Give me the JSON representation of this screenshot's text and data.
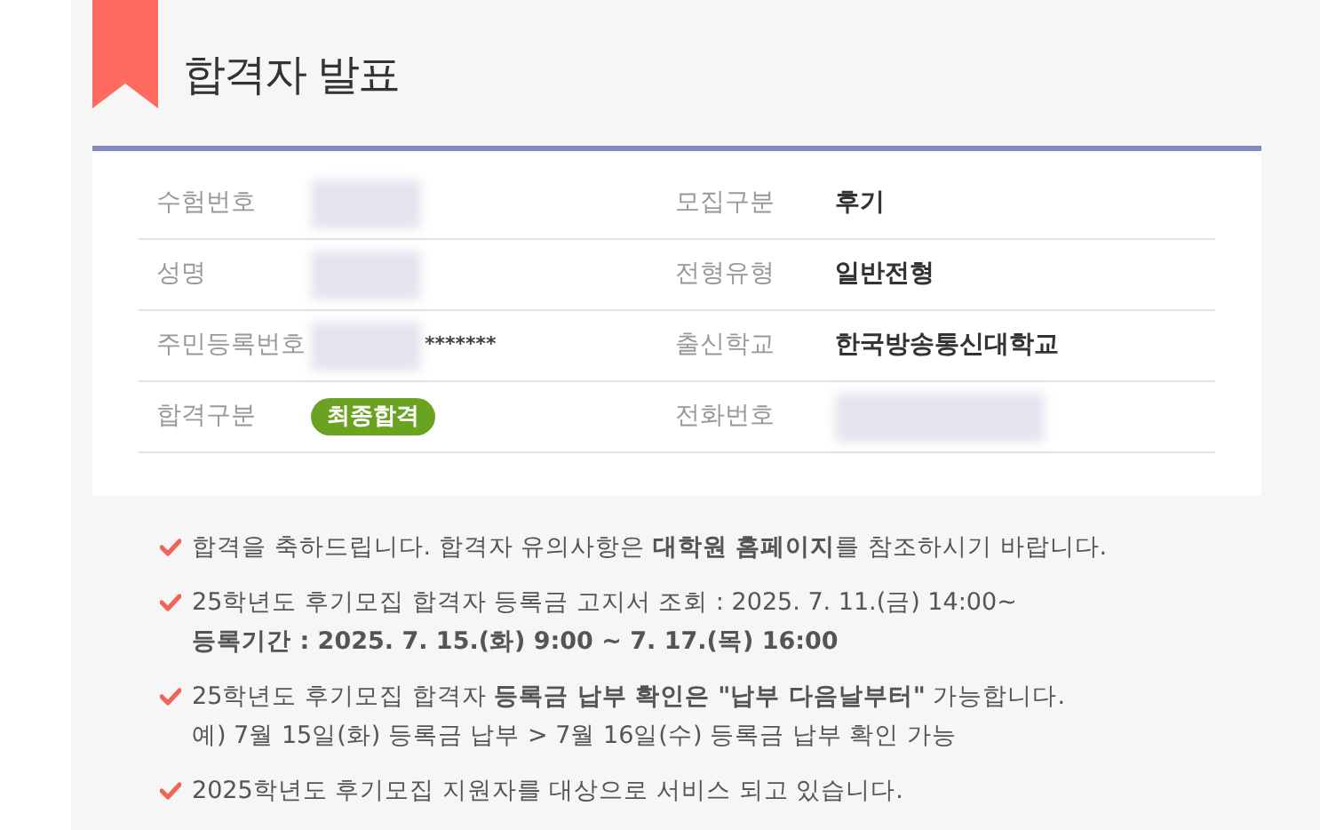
{
  "title": "합격자 발표",
  "rows": [
    {
      "left": {
        "label": "수험번호",
        "kind": "redacted"
      },
      "right": {
        "label": "모집구분",
        "kind": "text",
        "value": "후기"
      }
    },
    {
      "left": {
        "label": "성명",
        "kind": "redacted"
      },
      "right": {
        "label": "전형유형",
        "kind": "text",
        "value": "일반전형"
      }
    },
    {
      "left": {
        "label": "주민등록번호",
        "kind": "masked",
        "value": "*******"
      },
      "right": {
        "label": "출신학교",
        "kind": "text",
        "value": "한국방송통신대학교"
      }
    },
    {
      "left": {
        "label": "합격구분",
        "kind": "badge",
        "value": "최종합격"
      },
      "right": {
        "label": "전화번호",
        "kind": "redacted"
      }
    }
  ],
  "notes": [
    {
      "lines": [
        {
          "text": "합격을 축하드립니다. 합격자 유의사항은 **대학원 홈페이지**를 참조하시기 바랍니다.",
          "bold": false
        }
      ]
    },
    {
      "lines": [
        {
          "text": "25학년도 후기모집 합격자 등록금 고지서 조회 : 2025. 7. 11.(금) 14:00~",
          "bold": false
        },
        {
          "text": "등록기간 : 2025. 7. 15.(화) 9:00 ~ 7. 17.(목) 16:00",
          "bold": true
        }
      ]
    },
    {
      "lines": [
        {
          "text": "25학년도 후기모집 합격자 **등록금 납부 확인은 \"납부 다음날부터\"** 가능합니다.",
          "bold": false
        },
        {
          "text": "예) 7월 15일(화) 등록금 납부 > 7월 16일(수) 등록금 납부 확인 가능",
          "bold": false
        }
      ]
    },
    {
      "lines": [
        {
          "text": "2025학년도 후기모집 지원자를 대상으로 서비스 되고 있습니다.",
          "bold": false
        }
      ]
    }
  ]
}
